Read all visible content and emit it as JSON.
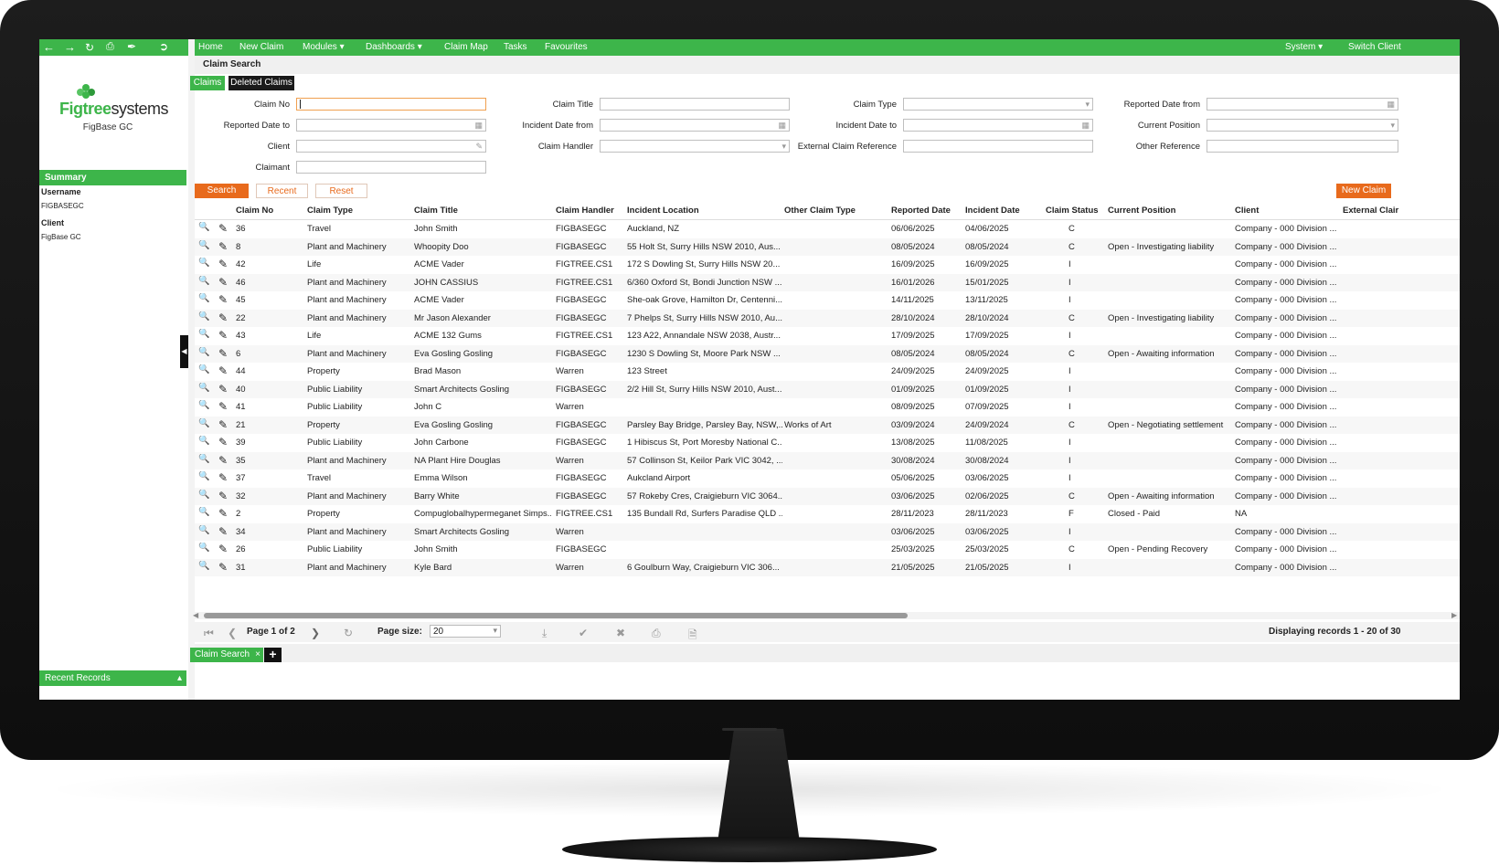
{
  "top_nav_left_icons": [
    "back-arrow-icon",
    "forward-arrow-icon",
    "refresh-icon",
    "print-icon",
    "brush-icon",
    "logout-icon"
  ],
  "top_menu": {
    "items": [
      "Home",
      "New Claim",
      "Modules",
      "Dashboards",
      "Claim Map",
      "Tasks",
      "Favourites"
    ],
    "system": "System",
    "switch_client": "Switch Client"
  },
  "sidebar": {
    "logo_bold": "Figtree",
    "logo_rest": "systems",
    "client_name": "FigBase GC",
    "summary_label": "Summary",
    "username_label": "Username",
    "username_value": "FIGBASEGC",
    "client_label": "Client",
    "client_value": "FigBase GC",
    "recent_records_label": "Recent Records"
  },
  "page_title": "Claim Search",
  "tabs": [
    "Claims",
    "Deleted Claims"
  ],
  "form": {
    "claim_no": "Claim No",
    "claim_title": "Claim Title",
    "claim_type": "Claim Type",
    "reported_date_from": "Reported Date from",
    "reported_date_to": "Reported Date to",
    "incident_date_from": "Incident Date from",
    "incident_date_to": "Incident Date to",
    "current_position": "Current Position",
    "client": "Client",
    "claim_handler": "Claim Handler",
    "external_claim_reference": "External Claim Reference",
    "other_reference": "Other Reference",
    "claimant": "Claimant"
  },
  "buttons": {
    "search": "Search",
    "recent": "Recent",
    "reset": "Reset",
    "new_claim": "New Claim"
  },
  "table": {
    "columns": [
      "Claim No",
      "Claim Type",
      "Claim Title",
      "Claim Handler",
      "Incident Location",
      "Other Claim Type",
      "Reported Date",
      "Incident Date",
      "Claim Status",
      "Current Position",
      "Client",
      "External Clair"
    ],
    "rows": [
      [
        "36",
        "Travel",
        "John Smith",
        "FIGBASEGC",
        "Auckland, NZ",
        "",
        "06/06/2025",
        "04/06/2025",
        "C",
        "",
        "Company - 000 Division ..."
      ],
      [
        "8",
        "Plant and Machinery",
        "Whoopity Doo",
        "FIGBASEGC",
        "55 Holt St, Surry Hills NSW 2010, Aus...",
        "",
        "08/05/2024",
        "08/05/2024",
        "C",
        "Open - Investigating liability",
        "Company - 000 Division ..."
      ],
      [
        "42",
        "Life",
        "ACME Vader",
        "FIGTREE.CS1",
        "172 S Dowling St, Surry Hills NSW 20...",
        "",
        "16/09/2025",
        "16/09/2025",
        "I",
        "",
        "Company - 000 Division ..."
      ],
      [
        "46",
        "Plant and Machinery",
        "JOHN CASSIUS",
        "FIGTREE.CS1",
        "6/360 Oxford St, Bondi Junction NSW ...",
        "",
        "16/01/2026",
        "15/01/2025",
        "I",
        "",
        "Company - 000 Division ..."
      ],
      [
        "45",
        "Plant and Machinery",
        "ACME Vader",
        "FIGBASEGC",
        "She-oak Grove, Hamilton Dr, Centenni...",
        "",
        "14/11/2025",
        "13/11/2025",
        "I",
        "",
        "Company - 000 Division ..."
      ],
      [
        "22",
        "Plant and Machinery",
        "Mr Jason Alexander",
        "FIGBASEGC",
        "7 Phelps St, Surry Hills NSW 2010, Au...",
        "",
        "28/10/2024",
        "28/10/2024",
        "C",
        "Open - Investigating liability",
        "Company - 000 Division ..."
      ],
      [
        "43",
        "Life",
        "ACME 132 Gums",
        "FIGTREE.CS1",
        "123 A22, Annandale NSW 2038, Austr...",
        "",
        "17/09/2025",
        "17/09/2025",
        "I",
        "",
        "Company - 000 Division ..."
      ],
      [
        "6",
        "Plant and Machinery",
        "Eva Gosling Gosling",
        "FIGBASEGC",
        "1230 S Dowling St, Moore Park NSW ...",
        "",
        "08/05/2024",
        "08/05/2024",
        "C",
        "Open - Awaiting information",
        "Company - 000 Division ..."
      ],
      [
        "44",
        "Property",
        "Brad Mason",
        "Warren",
        "123 Street",
        "",
        "24/09/2025",
        "24/09/2025",
        "I",
        "",
        "Company - 000 Division ..."
      ],
      [
        "40",
        "Public Liability",
        "Smart Architects Gosling",
        "FIGBASEGC",
        "2/2 Hill St, Surry Hills NSW 2010, Aust...",
        "",
        "01/09/2025",
        "01/09/2025",
        "I",
        "",
        "Company - 000 Division ..."
      ],
      [
        "41",
        "Public Liability",
        "John C",
        "Warren",
        "",
        "",
        "08/09/2025",
        "07/09/2025",
        "I",
        "",
        "Company - 000 Division ..."
      ],
      [
        "21",
        "Property",
        "Eva Gosling Gosling",
        "FIGBASEGC",
        "Parsley Bay Bridge, Parsley Bay, NSW,...",
        "Works of Art",
        "03/09/2024",
        "24/09/2024",
        "C",
        "Open - Negotiating settlement",
        "Company - 000 Division ..."
      ],
      [
        "39",
        "Public Liability",
        "John Carbone",
        "FIGBASEGC",
        "1 Hibiscus St, Port Moresby National C...",
        "",
        "13/08/2025",
        "11/08/2025",
        "I",
        "",
        "Company - 000 Division ..."
      ],
      [
        "35",
        "Plant and Machinery",
        "NA Plant Hire Douglas",
        "Warren",
        "57 Collinson St, Keilor Park VIC 3042, ...",
        "",
        "30/08/2024",
        "30/08/2024",
        "I",
        "",
        "Company - 000 Division ..."
      ],
      [
        "37",
        "Travel",
        "Emma Wilson",
        "FIGBASEGC",
        "Aukcland Airport",
        "",
        "05/06/2025",
        "03/06/2025",
        "I",
        "",
        "Company - 000 Division ..."
      ],
      [
        "32",
        "Plant and Machinery",
        "Barry White",
        "FIGBASEGC",
        "57 Rokeby Cres, Craigieburn VIC 3064...",
        "",
        "03/06/2025",
        "02/06/2025",
        "C",
        "Open - Awaiting information",
        "Company - 000 Division ..."
      ],
      [
        "2",
        "Property",
        "Compuglobalhypermeganet Simps...",
        "FIGTREE.CS1",
        "135 Bundall Rd, Surfers Paradise QLD ...",
        "",
        "28/11/2023",
        "28/11/2023",
        "F",
        "Closed - Paid",
        "NA"
      ],
      [
        "34",
        "Plant and Machinery",
        "Smart Architects Gosling",
        "Warren",
        "",
        "",
        "03/06/2025",
        "03/06/2025",
        "I",
        "",
        "Company - 000 Division ..."
      ],
      [
        "26",
        "Public Liability",
        "John Smith",
        "FIGBASEGC",
        "",
        "",
        "25/03/2025",
        "25/03/2025",
        "C",
        "Open - Pending Recovery",
        "Company - 000 Division ..."
      ],
      [
        "31",
        "Plant and Machinery",
        "Kyle Bard",
        "Warren",
        "6 Goulburn Way, Craigieburn VIC 306...",
        "",
        "21/05/2025",
        "21/05/2025",
        "I",
        "",
        "Company - 000 Division ..."
      ]
    ]
  },
  "pager": {
    "page_text": "Page 1 of 2",
    "page_size_label": "Page size:",
    "page_size_value": "20",
    "displaying": "Displaying records 1 - 20 of 30"
  },
  "bottom_tab": "Claim Search",
  "colors": {
    "accent_green": "#3db54a",
    "accent_orange": "#e86a1c",
    "dark": "#1a1a1a"
  }
}
